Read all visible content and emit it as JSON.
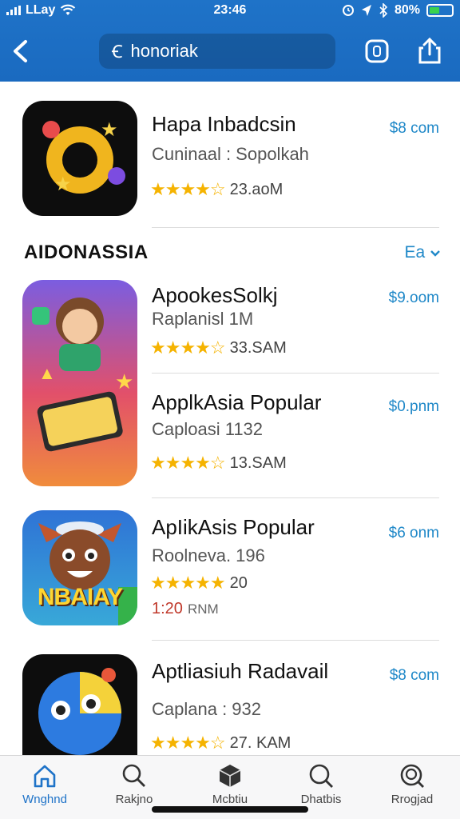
{
  "status": {
    "carrier": "LLay",
    "time": "23:46",
    "battery": "80%"
  },
  "header": {
    "search_value": "honoriak",
    "search_glyph": "Ꞓ"
  },
  "apps": [
    {
      "title": "Hapa  Inbadcsin",
      "subtitle": "Cuninaal : Sopolkah",
      "stars": "★★★★☆",
      "rating": "23.aoM",
      "price": "$8 com"
    },
    {
      "title": "ApookesSolkj",
      "subtitle": "Raplanisl 1M",
      "stars": "★★★★☆",
      "rating": "33.SAM",
      "price": "$9.oom"
    },
    {
      "title": "ApplkAsia Popular",
      "subtitle": "Caploasi 1132",
      "stars": "★★★★☆",
      "rating": "13.SAM",
      "price": "$0.pnm"
    },
    {
      "title": "ApIikAsis Popular",
      "subtitle": "Roolneva. 196",
      "stars": "★★★★★",
      "rating": "20",
      "extra": "1:20",
      "extra_unit": "RNM",
      "price": "$6 onm",
      "icon_text": "NBAIAY"
    },
    {
      "title": "Aptliasiuh Radavail",
      "subtitle": "Caplana : 932",
      "stars": "★★★★☆",
      "rating": "27. KAM",
      "price": "$8 com"
    }
  ],
  "section": {
    "title": "AIDONASSIA",
    "more": "Ea"
  },
  "tabs": [
    {
      "label": "Wnghnd"
    },
    {
      "label": "Rakjno"
    },
    {
      "label": "Mcbtiu"
    },
    {
      "label": "Dhatbis"
    },
    {
      "label": "Rrogjad"
    }
  ],
  "colors": {
    "header_blue": "#1f73c8",
    "accent": "#1f88c8",
    "star": "#f5b301",
    "red_text": "#c0392b"
  }
}
